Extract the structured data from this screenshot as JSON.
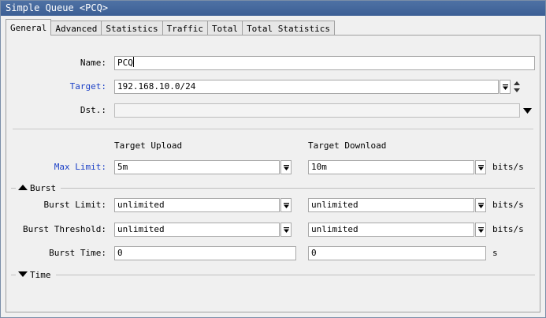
{
  "window": {
    "title": "Simple Queue <PCQ>"
  },
  "tabs": [
    "General",
    "Advanced",
    "Statistics",
    "Traffic",
    "Total",
    "Total Statistics"
  ],
  "form": {
    "name": {
      "label": "Name:",
      "value": "PCQ"
    },
    "target": {
      "label": "Target:",
      "value": "192.168.10.0/24"
    },
    "dst": {
      "label": "Dst.:",
      "value": ""
    },
    "columns": {
      "upload": "Target Upload",
      "download": "Target Download"
    },
    "max_limit": {
      "label": "Max Limit:",
      "upload": "5m",
      "download": "10m",
      "unit": "bits/s"
    },
    "burst_section": {
      "label": "Burst"
    },
    "burst_limit": {
      "label": "Burst Limit:",
      "upload": "unlimited",
      "download": "unlimited",
      "unit": "bits/s"
    },
    "burst_threshold": {
      "label": "Burst Threshold:",
      "upload": "unlimited",
      "download": "unlimited",
      "unit": "bits/s"
    },
    "burst_time": {
      "label": "Burst Time:",
      "upload": "0",
      "download": "0",
      "unit": "s"
    },
    "time_section": {
      "label": "Time"
    }
  },
  "colors": {
    "titlebar": "#3c5f95",
    "label_link": "#1a3fc6"
  }
}
